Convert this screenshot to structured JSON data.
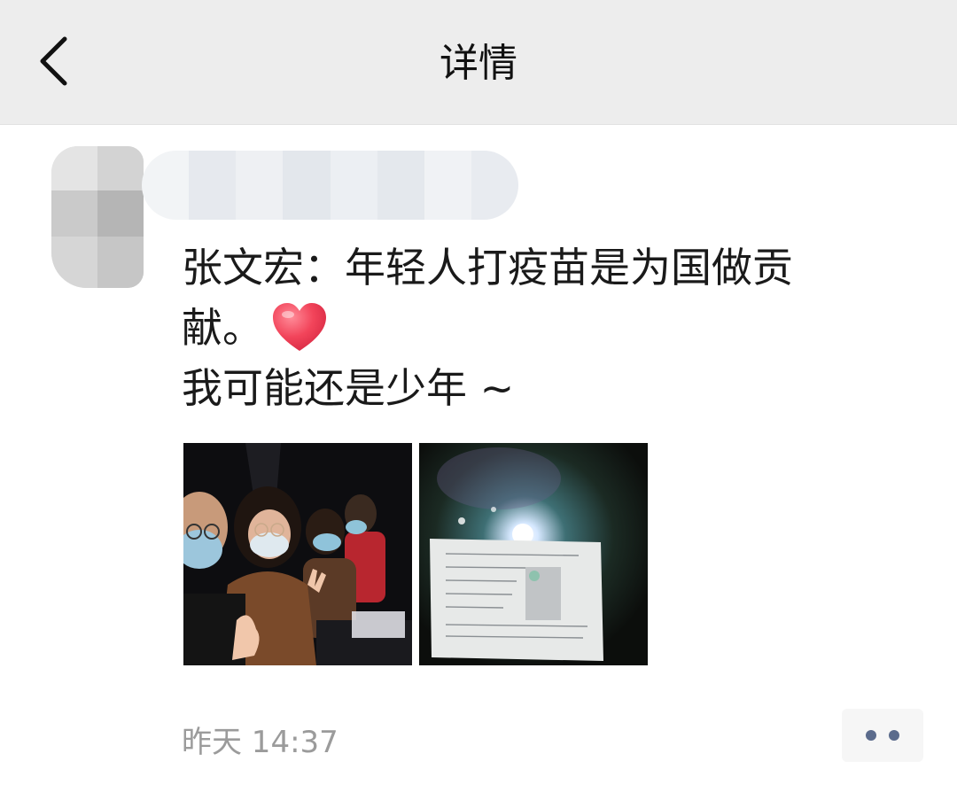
{
  "header": {
    "title": "详情",
    "back_icon": "chevron-left-icon"
  },
  "post": {
    "text_lines": [
      "张文宏：年轻人打疫苗是为国做贡",
      "献。",
      "我可能还是少年 ~"
    ],
    "emoji": "heart-icon",
    "photos": [
      {
        "name": "group-selfie-photo"
      },
      {
        "name": "vaccination-certificate-photo"
      }
    ],
    "timestamp": "昨天 14:37",
    "more_icon": "more-dots-icon"
  },
  "colors": {
    "topbar": "#ededed",
    "title": "#111111",
    "timestamp": "#9b9b9b",
    "more_dots": "#5b6b8c",
    "heart": "#f2445a"
  }
}
